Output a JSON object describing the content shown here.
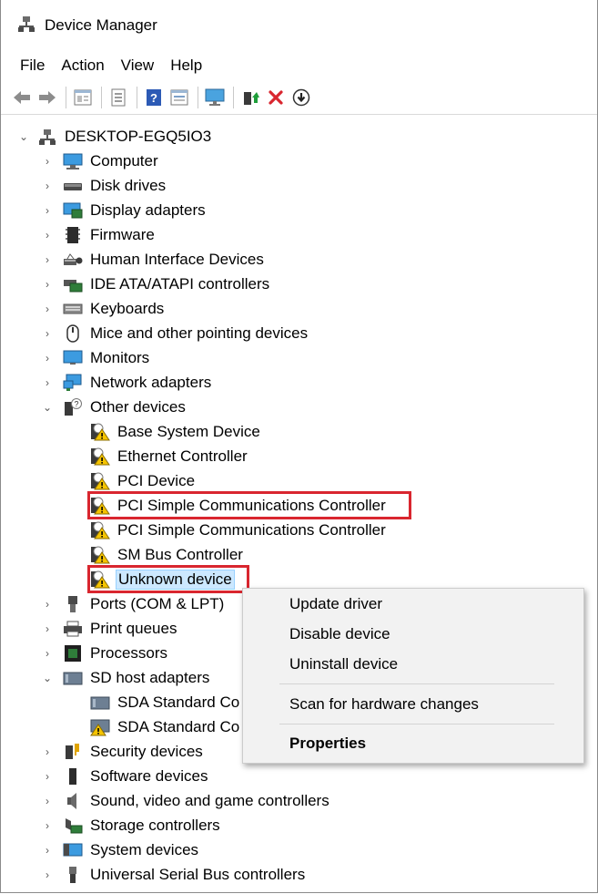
{
  "window": {
    "title": "Device Manager"
  },
  "menubar": {
    "items": [
      "File",
      "Action",
      "View",
      "Help"
    ]
  },
  "toolbar": {
    "buttons": [
      "back-icon",
      "forward-icon",
      "properties-icon",
      "show-hide-icon",
      "help-icon",
      "view-icon",
      "monitor-icon",
      "update-driver-icon",
      "uninstall-icon",
      "enable-device-icon"
    ]
  },
  "tree": {
    "root": "DESKTOP-EGQ5IO3",
    "categories": [
      {
        "label": "Computer",
        "icon": "computer-icon",
        "expanded": false
      },
      {
        "label": "Disk drives",
        "icon": "disk-drive-icon",
        "expanded": false
      },
      {
        "label": "Display adapters",
        "icon": "display-adapter-icon",
        "expanded": false
      },
      {
        "label": "Firmware",
        "icon": "firmware-icon",
        "expanded": false
      },
      {
        "label": "Human Interface Devices",
        "icon": "hid-icon",
        "expanded": false
      },
      {
        "label": "IDE ATA/ATAPI controllers",
        "icon": "ide-controller-icon",
        "expanded": false
      },
      {
        "label": "Keyboards",
        "icon": "keyboard-icon",
        "expanded": false
      },
      {
        "label": "Mice and other pointing devices",
        "icon": "mouse-icon",
        "expanded": false
      },
      {
        "label": "Monitors",
        "icon": "monitor-icon",
        "expanded": false
      },
      {
        "label": "Network adapters",
        "icon": "network-adapter-icon",
        "expanded": false
      },
      {
        "label": "Other devices",
        "icon": "unknown-device-icon",
        "expanded": true,
        "children": [
          "Base System Device",
          "Ethernet Controller",
          "PCI Device",
          "PCI Simple Communications Controller",
          "PCI Simple Communications Controller",
          "SM Bus Controller",
          "Unknown device"
        ]
      },
      {
        "label": "Ports (COM & LPT)",
        "icon": "port-icon",
        "expanded": false
      },
      {
        "label": "Print queues",
        "icon": "printer-icon",
        "expanded": false
      },
      {
        "label": "Processors",
        "icon": "processor-icon",
        "expanded": false
      },
      {
        "label": "SD host adapters",
        "icon": "sd-adapter-icon",
        "expanded": true,
        "children": [
          "SDA Standard Co",
          "SDA Standard Co"
        ]
      },
      {
        "label": "Security devices",
        "icon": "security-device-icon",
        "expanded": false
      },
      {
        "label": "Software devices",
        "icon": "software-device-icon",
        "expanded": false
      },
      {
        "label": "Sound, video and game controllers",
        "icon": "speaker-icon",
        "expanded": false
      },
      {
        "label": "Storage controllers",
        "icon": "storage-controller-icon",
        "expanded": false
      },
      {
        "label": "System devices",
        "icon": "system-device-icon",
        "expanded": false
      },
      {
        "label": "Universal Serial Bus controllers",
        "icon": "usb-icon",
        "expanded": false
      }
    ]
  },
  "context_menu": {
    "items": [
      "Update driver",
      "Disable device",
      "Uninstall device",
      "Scan for hardware changes",
      "Properties"
    ]
  },
  "colors": {
    "highlight_border": "#d9262f",
    "selection_bg": "#cce8ff",
    "warning": "#f5c400"
  }
}
